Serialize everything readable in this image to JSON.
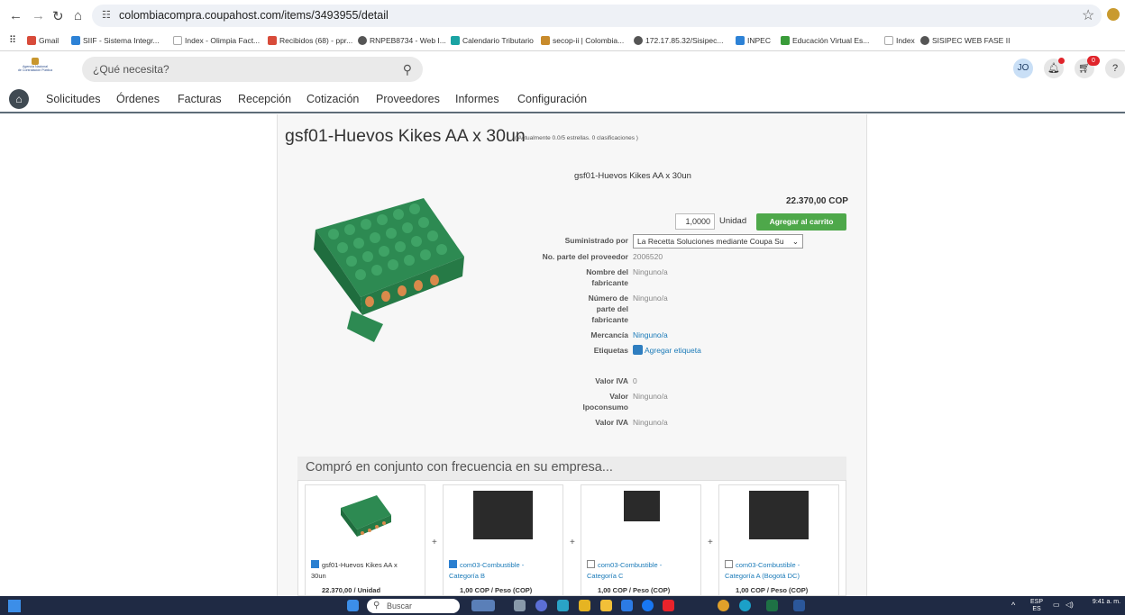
{
  "browser": {
    "url": "colombiacompra.coupahost.com/items/3493955/detail",
    "bookmarks": [
      "Gmail",
      "SIIF - Sistema Integr...",
      "Index - Olimpia Fact...",
      "Recibidos (68) - ppr...",
      "RNPEB8734 - Web I...",
      "Calendario Tributario",
      "secop-ii | Colombia...",
      "172.17.85.32/Sisipec...",
      "INPEC",
      "Educación Virtual Es...",
      "Index",
      "SISIPEC WEB FASE II"
    ]
  },
  "header": {
    "logo_line1": "Agencia Nacional",
    "logo_line2": "de Contratación Pública",
    "search_placeholder": "¿Qué necesita?",
    "avatar": "JO",
    "cart_count": "0",
    "help": "?"
  },
  "nav": [
    "Solicitudes",
    "Órdenes",
    "Facturas",
    "Recepción",
    "Cotización",
    "Proveedores",
    "Informes",
    "Configuración"
  ],
  "product": {
    "title": "gsf01-Huevos Kikes AA x 30un",
    "rating": "( Actualmente 0.0/5 estrellas. 0 clasificaciones )",
    "name": "gsf01-Huevos Kikes AA x 30un",
    "price": "22.370,00 COP",
    "quantity": "1,0000",
    "unit": "Unidad",
    "add_to_cart": "Agregar al carrito",
    "fields": {
      "supplied_by_label": "Suministrado por",
      "supplied_by_value": "La Recetta Soluciones mediante Coupa Su",
      "part_no_label": "No. parte del proveedor",
      "part_no_value": "2006520",
      "manufacturer_label": "Nombre del fabricante",
      "manufacturer_value": "Ninguno/a",
      "mfr_part_label": "Número de parte del fabricante",
      "mfr_part_value": "Ninguno/a",
      "commodity_label": "Mercancía",
      "commodity_value": "Ninguno/a",
      "tags_label": "Etiquetas",
      "tags_value": "Agregar etiqueta",
      "iva_label": "Valor IVA",
      "iva_value": "0",
      "ipoconsumo_label": "Valor Ipoconsumo",
      "ipoconsumo_value": "Ninguno/a",
      "iva2_label": "Valor IVA",
      "iva2_value": "Ninguno/a"
    }
  },
  "frequently_bought": {
    "heading": "Compró en conjunto con frecuencia en su empresa...",
    "items": [
      {
        "name": "gsf01-Huevos Kikes AA x 30un",
        "price": "22.370,00 / Unidad",
        "checked": true
      },
      {
        "name": "com03-Combustible - Categoría B",
        "price": "1,00 COP / Peso (COP)",
        "checked": true
      },
      {
        "name": "com03-Combustible - Categoría C",
        "price": "1,00 COP / Peso (COP)",
        "checked": false
      },
      {
        "name": "com03-Combustible - Categoría A (Bogotá DC)",
        "price": "1,00 COP / Peso (COP)",
        "checked": false
      }
    ]
  },
  "taskbar": {
    "search": "Buscar",
    "lang": "ESP",
    "lang_sub": "ES",
    "time": "9:41 a. m."
  }
}
